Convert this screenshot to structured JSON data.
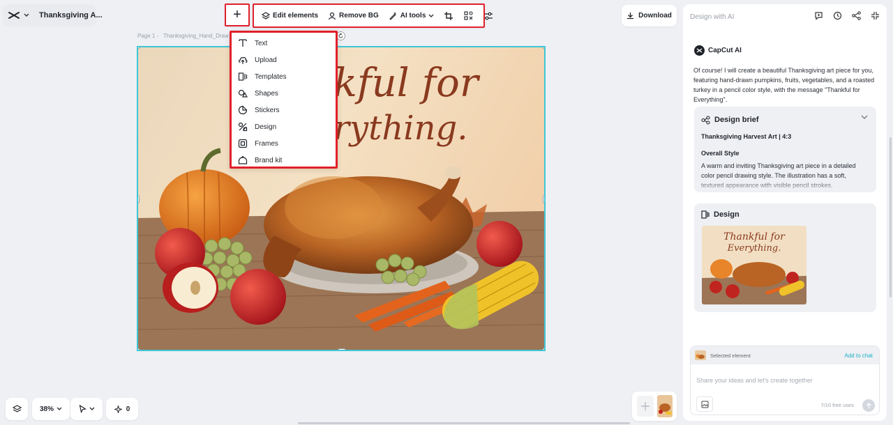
{
  "header": {
    "title": "Thanksgiving A..."
  },
  "toolbar": {
    "plus_label": "+",
    "edit_elements": "Edit elements",
    "remove_bg": "Remove BG",
    "ai_tools": "AI tools"
  },
  "download_label": "Download",
  "canvas": {
    "page_label": "Page 1 -",
    "file_name": "Thanksgiving_Hand_Draw",
    "art_line1": "kful for",
    "art_line2": "rything."
  },
  "add_menu": {
    "items": [
      {
        "label": "Text",
        "icon": "text-icon"
      },
      {
        "label": "Upload",
        "icon": "upload-icon"
      },
      {
        "label": "Templates",
        "icon": "templates-icon"
      },
      {
        "label": "Shapes",
        "icon": "shapes-icon"
      },
      {
        "label": "Stickers",
        "icon": "stickers-icon"
      },
      {
        "label": "Design",
        "icon": "design-icon"
      },
      {
        "label": "Frames",
        "icon": "frames-icon"
      },
      {
        "label": "Brand kit",
        "icon": "brand-kit-icon"
      }
    ]
  },
  "panel": {
    "title": "Design with AI",
    "ai_name": "CapCut AI",
    "ai_message": "Of course! I will create a beautiful Thanksgiving art piece for you, featuring hand-drawn pumpkins, fruits, vegetables, and a roasted turkey in a pencil color style, with the message \"Thankful for Everything\".",
    "brief": {
      "title": "Design brief",
      "subtitle": "Thanksgiving Harvest Art | 4:3",
      "section": "Overall Style",
      "desc": "A warm and inviting Thanksgiving art piece in a detailed color pencil drawing style. The illustration has a soft, textured appearance with visible pencil strokes."
    },
    "design": {
      "title": "Design",
      "thumb_line1": "Thankful for",
      "thumb_line2": "Everything."
    },
    "chat": {
      "selected_label": "Selected element",
      "add_to_chat": "Add to chat",
      "placeholder": "Share your ideas and let's create together",
      "free_uses": "7/10 free uses"
    }
  },
  "bottom": {
    "zoom": "38%",
    "ai_count": "0"
  }
}
